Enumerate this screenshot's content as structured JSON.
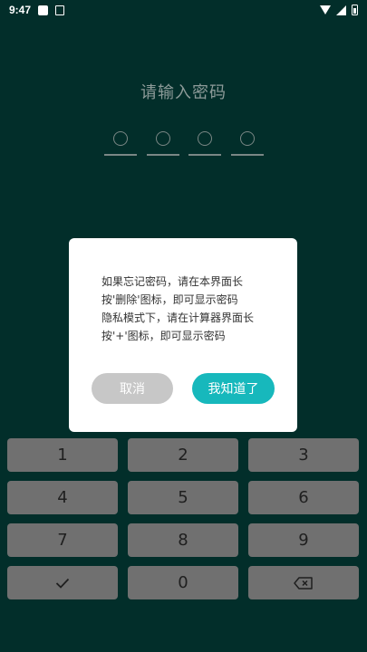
{
  "status_bar": {
    "time": "9:47"
  },
  "lock_screen": {
    "prompt": "请输入密码",
    "pin_slots": 4
  },
  "dialog": {
    "message_lines": [
      "如果忘记密码，请在本界面长",
      "按'删除'图标，即可显示密码",
      "隐私模式下，请在计算器界面长",
      "按'+'图标，即可显示密码"
    ],
    "cancel_label": "取消",
    "confirm_label": "我知道了"
  },
  "keypad": {
    "keys": [
      "1",
      "2",
      "3",
      "4",
      "5",
      "6",
      "7",
      "8",
      "9",
      "",
      "0",
      ""
    ],
    "check_icon": "check-icon",
    "backspace_icon": "backspace-icon"
  },
  "colors": {
    "background": "#022e2a",
    "accent": "#17b8bc",
    "key_bg": "#707070"
  }
}
